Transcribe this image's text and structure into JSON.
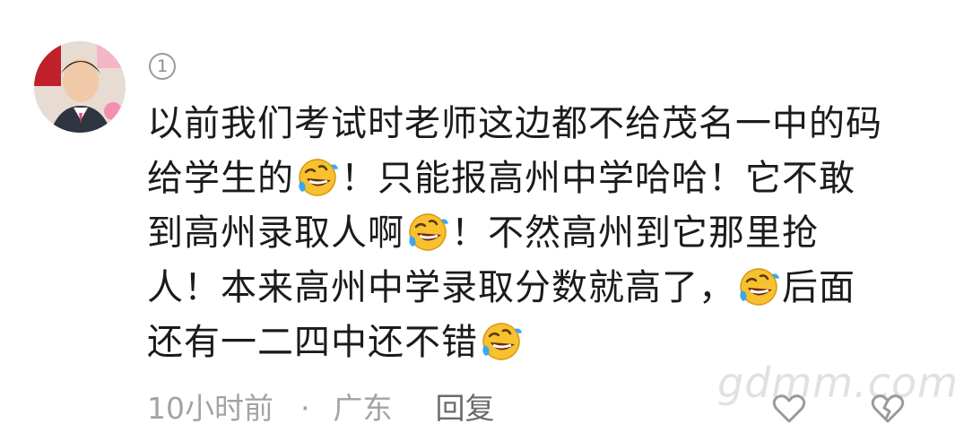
{
  "comment": {
    "floor_number": "1",
    "avatar_icon": "user-avatar-photo",
    "text_lines": [
      {
        "before": "以前我们考试时老师这边都不给茂名一中的码",
        "emoji": "",
        "after": ""
      },
      {
        "before": "给学生的",
        "emoji": "rofl-emoji",
        "after": "！只能报高州中学哈哈！它不敢"
      },
      {
        "before": "到高州录取人啊",
        "emoji": "rofl-emoji",
        "after": "！不然高州到它那里抢"
      },
      {
        "before": "人！本来高州中学录取分数就高了，",
        "emoji": "rofl-emoji",
        "after": "后面"
      },
      {
        "before": "还有一二四中还不错",
        "emoji": "rofl-emoji",
        "after": ""
      }
    ],
    "meta": {
      "time": "10小时前",
      "separator": "·",
      "location": "广东",
      "reply_label": "回复"
    },
    "watermark": "gdmm.com",
    "like_icon": "heart-outline-icon",
    "dislike_icon": "broken-heart-icon"
  },
  "colors": {
    "text": "#1b1b1b",
    "meta": "#a3a3a3",
    "reply": "#6b6b6b",
    "emoji_face": "#f7c12f",
    "emoji_tear": "#3aa7f0"
  }
}
